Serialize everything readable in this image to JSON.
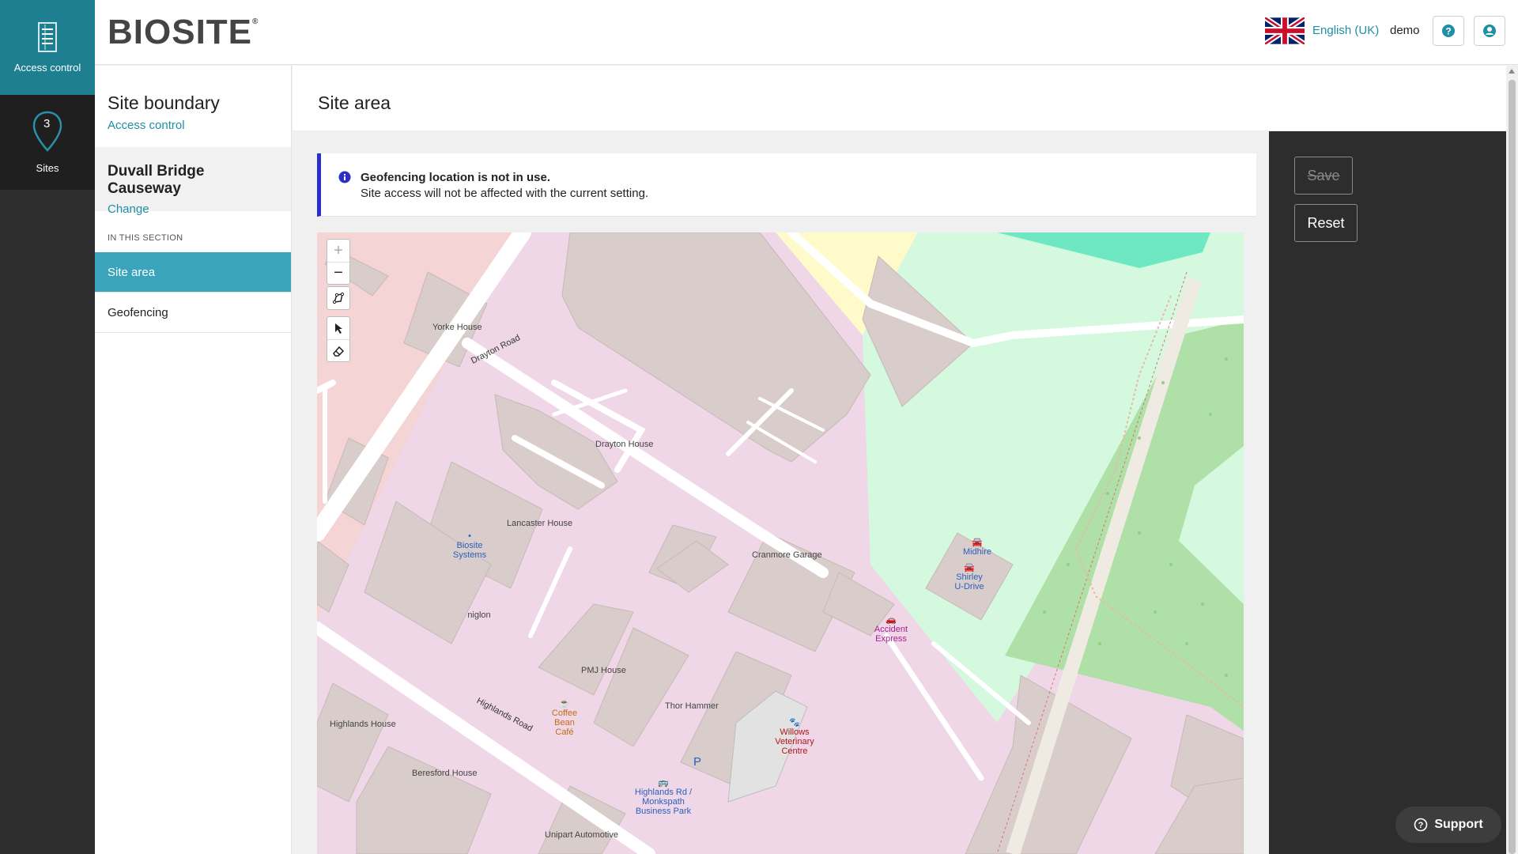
{
  "rail": {
    "access_control_label": "Access control",
    "sites_label": "Sites",
    "sites_count": "3"
  },
  "header": {
    "logo": "BIOSITE",
    "logo_mark": "®",
    "language": "English (UK)",
    "user": "demo",
    "help_icon": "help-circle-icon",
    "account_icon": "user-circle-icon"
  },
  "sidebar": {
    "title": "Site boundary",
    "parent_link": "Access control",
    "site_name": "Duvall Bridge Causeway",
    "change_link": "Change",
    "section_label": "IN THIS SECTION",
    "items": [
      {
        "label": "Site area",
        "active": true
      },
      {
        "label": "Geofencing",
        "active": false
      }
    ]
  },
  "main": {
    "title": "Site area",
    "notice": {
      "heading": "Geofencing location is not in use.",
      "body": "Site access will not be affected with the current setting."
    }
  },
  "map": {
    "controls": {
      "zoom_in": "+",
      "zoom_out": "−"
    },
    "roads": [
      "Drayton Road",
      "Highlands Road"
    ],
    "buildings": [
      "Yorke House",
      "Drayton House",
      "Lancaster House",
      "Cranmore Garage",
      "niglon",
      "PMJ House",
      "Thor Hammer",
      "Highlands House",
      "Beresford House",
      "Unipart Automotive"
    ],
    "pois": {
      "biosite": "Biosite Systems",
      "midhire": "Midhire",
      "shirley": "Shirley U-Drive",
      "accident": "Accident Express",
      "coffee": "Coffee Bean Café",
      "vet": "Willows Veterinary Centre",
      "bus": "Highlands Rd / Monkspath Business Park",
      "parking": "P"
    }
  },
  "actions": {
    "save_label": "Save",
    "reset_label": "Reset"
  },
  "support_label": "Support",
  "colors": {
    "accent": "#1e8fa4",
    "active_nav": "#3aa4bc",
    "notice_border": "#2a2fc7",
    "panel": "#2d2d2d"
  }
}
